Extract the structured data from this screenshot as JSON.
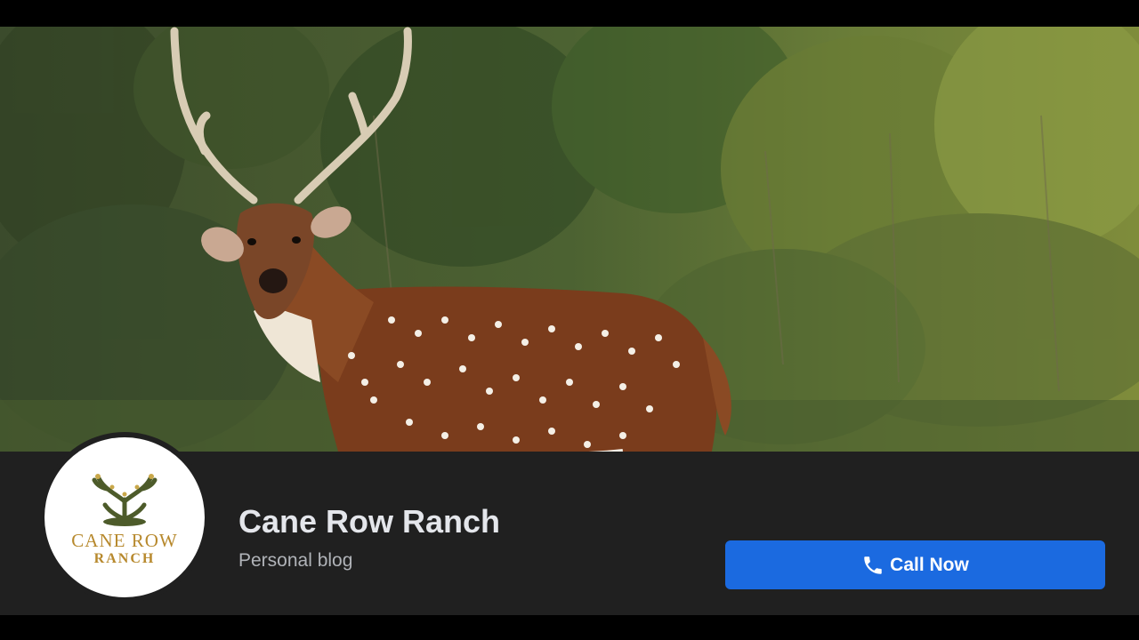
{
  "cover": {
    "subject_icon": "deer-photo"
  },
  "profile": {
    "logo": {
      "line1": "CANE ROW",
      "line2": "RANCH"
    },
    "name": "Cane Row Ranch",
    "category": "Personal blog"
  },
  "actions": {
    "call_label": "Call Now",
    "call_icon": "phone-icon"
  },
  "colors": {
    "background": "#202020",
    "accent": "#1b6ae0",
    "name_text": "#e4e6eb",
    "category_text": "#b0b3b8",
    "logo_gold": "#b7892d",
    "logo_green": "#4d5b2a"
  }
}
